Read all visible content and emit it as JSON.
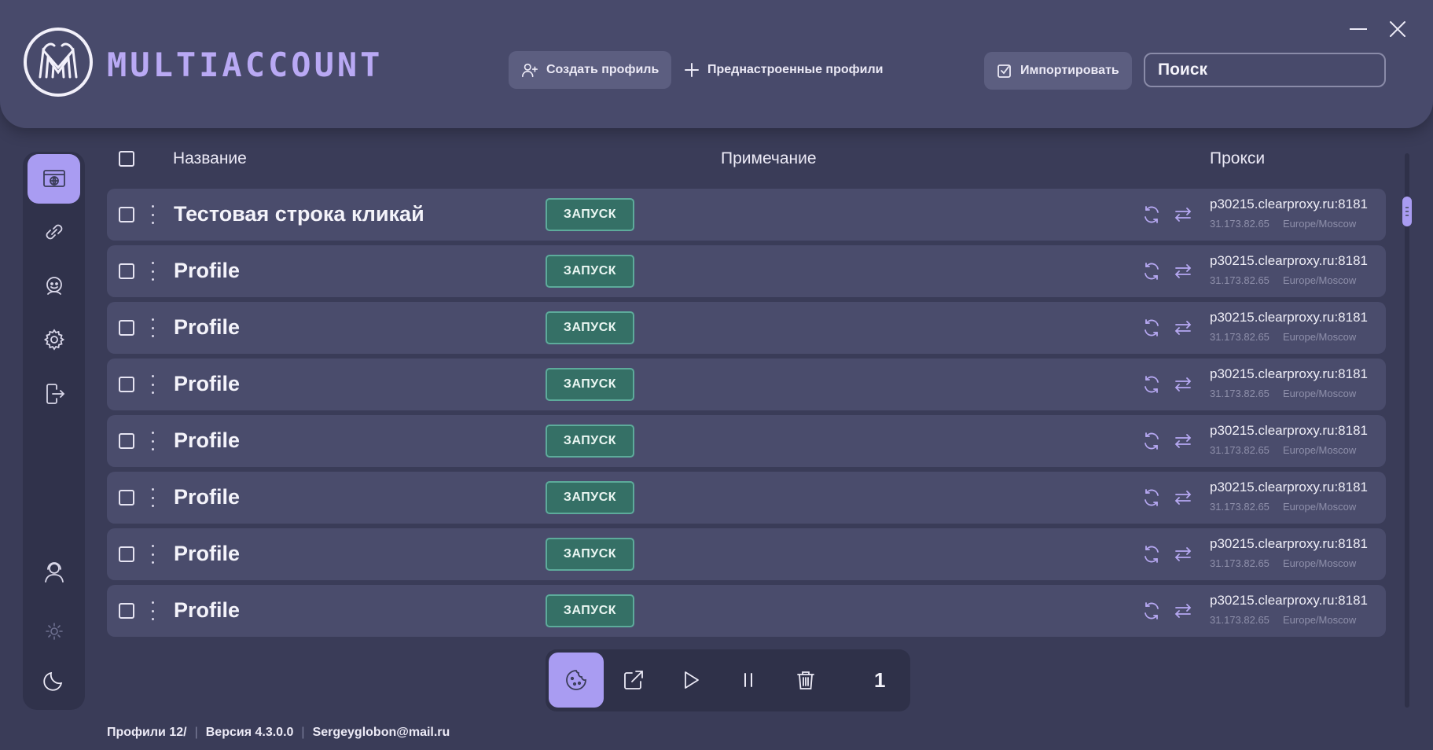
{
  "app": {
    "name": "MULTIACCOUNT",
    "brand_color": "#b9a9f4",
    "accent_color": "#a99cf2"
  },
  "header": {
    "create_profile_label": "Создать профиль",
    "preset_profiles_label": "Преднастроенные профили",
    "import_label": "Импортировать",
    "search_placeholder": "Поиск"
  },
  "sidebar": {
    "items": [
      {
        "icon": "browser-globe-icon",
        "active": true
      },
      {
        "icon": "link-icon",
        "active": false
      },
      {
        "icon": "mask-icon",
        "active": false
      },
      {
        "icon": "gear-icon",
        "active": false
      },
      {
        "icon": "logout-icon",
        "active": false
      },
      {
        "icon": "support-agent-icon",
        "active": false
      },
      {
        "icon": "sun-icon",
        "active": false
      },
      {
        "icon": "moon-icon",
        "active": false
      }
    ]
  },
  "table": {
    "columns": {
      "name": "Название",
      "note": "Примечание",
      "proxy": "Прокси"
    },
    "launch_label": "ЗАПУСК",
    "launch_color": "#357066",
    "rows": [
      {
        "name": "Тестовая строка кликай",
        "proxy": "p30215.clearproxy.ru:8181",
        "ip": "31.173.82.65",
        "timezone": "Europe/Moscow"
      },
      {
        "name": "Profile",
        "proxy": "p30215.clearproxy.ru:8181",
        "ip": "31.173.82.65",
        "timezone": "Europe/Moscow"
      },
      {
        "name": "Profile",
        "proxy": "p30215.clearproxy.ru:8181",
        "ip": "31.173.82.65",
        "timezone": "Europe/Moscow"
      },
      {
        "name": "Profile",
        "proxy": "p30215.clearproxy.ru:8181",
        "ip": "31.173.82.65",
        "timezone": "Europe/Moscow"
      },
      {
        "name": "Profile",
        "proxy": "p30215.clearproxy.ru:8181",
        "ip": "31.173.82.65",
        "timezone": "Europe/Moscow"
      },
      {
        "name": "Profile",
        "proxy": "p30215.clearproxy.ru:8181",
        "ip": "31.173.82.65",
        "timezone": "Europe/Moscow"
      },
      {
        "name": "Profile",
        "proxy": "p30215.clearproxy.ru:8181",
        "ip": "31.173.82.65",
        "timezone": "Europe/Moscow"
      },
      {
        "name": "Profile",
        "proxy": "p30215.clearproxy.ru:8181",
        "ip": "31.173.82.65",
        "timezone": "Europe/Moscow"
      }
    ]
  },
  "toolbar": {
    "icons": [
      "cookie-icon",
      "export-icon",
      "play-icon",
      "pause-icon",
      "trash-icon"
    ],
    "selected_count": "1"
  },
  "footer": {
    "profiles": "Профили 12/",
    "version": "Версия 4.3.0.0",
    "email": "Sergeyglobon@mail.ru"
  }
}
